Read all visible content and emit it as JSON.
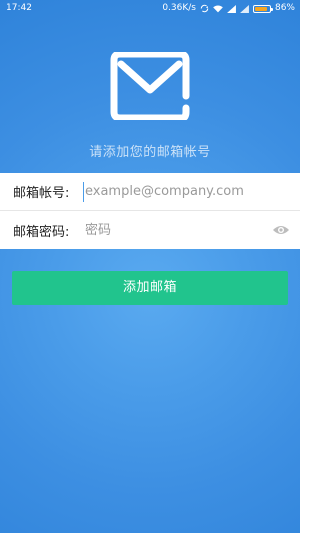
{
  "status_bar": {
    "time": "17:42",
    "network_speed": "0.36K/s",
    "battery_percent_label": "86%",
    "battery_level": 0.86,
    "icons": [
      "sync-icon",
      "wifi-icon",
      "signal-icon",
      "signal-icon",
      "battery-icon"
    ]
  },
  "header": {
    "logo_icon": "mail-icon",
    "prompt": "请添加您的邮箱帐号"
  },
  "form": {
    "account_label": "邮箱帐号:",
    "account_placeholder": "example@company.com",
    "password_label": "邮箱密码:",
    "password_placeholder": "密码",
    "password_toggle_icon": "eye-icon"
  },
  "actions": {
    "submit_label": "添加邮箱"
  },
  "colors": {
    "background": "#3d8fe2",
    "button": "#21c48d",
    "battery": "#f5a623"
  }
}
